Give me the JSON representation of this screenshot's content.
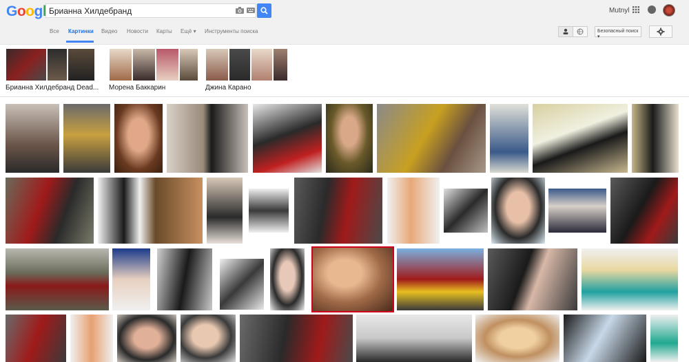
{
  "logo": {
    "letters": [
      "G",
      "o",
      "o",
      "g",
      "l",
      "e"
    ],
    "colors": [
      "#4285f4",
      "#ea4335",
      "#fbbc05",
      "#4285f4",
      "#34a853",
      "#ea4335"
    ]
  },
  "search": {
    "query": "Брианна Хилдебранд"
  },
  "account": {
    "user_name": "Mutnyl"
  },
  "tabs": {
    "all": "Все",
    "images": "Картинки",
    "videos": "Видео",
    "news": "Новости",
    "maps": "Карты",
    "more": "Ещё ▾",
    "tools": "Инструменты поиска"
  },
  "toolbar": {
    "safe_search": "Безопасный поиск ▾"
  },
  "related": [
    {
      "label": "Брианна Хилдебранд Dead..."
    },
    {
      "label": "Морена Баккарин"
    },
    {
      "label": "Джина Карано"
    }
  ],
  "colors": {
    "accent": "#4285f4",
    "selection": "#d0021b"
  }
}
